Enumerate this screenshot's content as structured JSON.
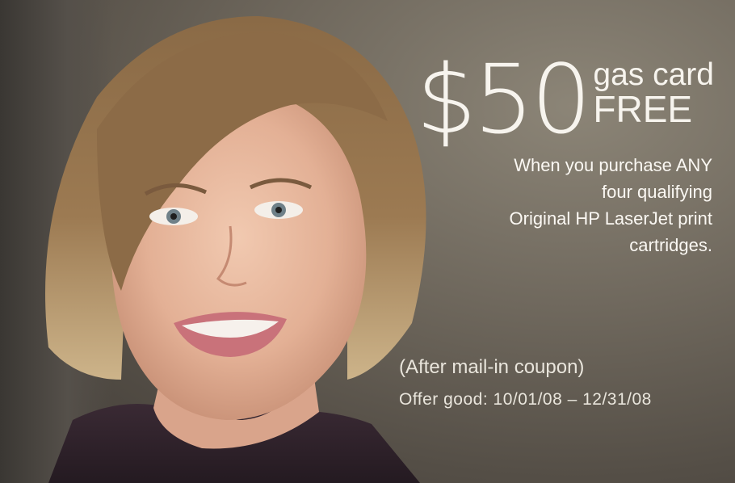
{
  "ad": {
    "amount": "$50",
    "gas_card": "gas card",
    "free": "FREE",
    "body_lines": [
      "When you purchase ANY",
      "four qualifying",
      "Original HP LaserJet print",
      "cartridges."
    ],
    "coupon_note": "(After mail-in coupon)",
    "offer_dates": "Offer good: 10/01/08 – 12/31/08"
  },
  "colors": {
    "text": "#ffffff",
    "background": "#6f685d"
  }
}
